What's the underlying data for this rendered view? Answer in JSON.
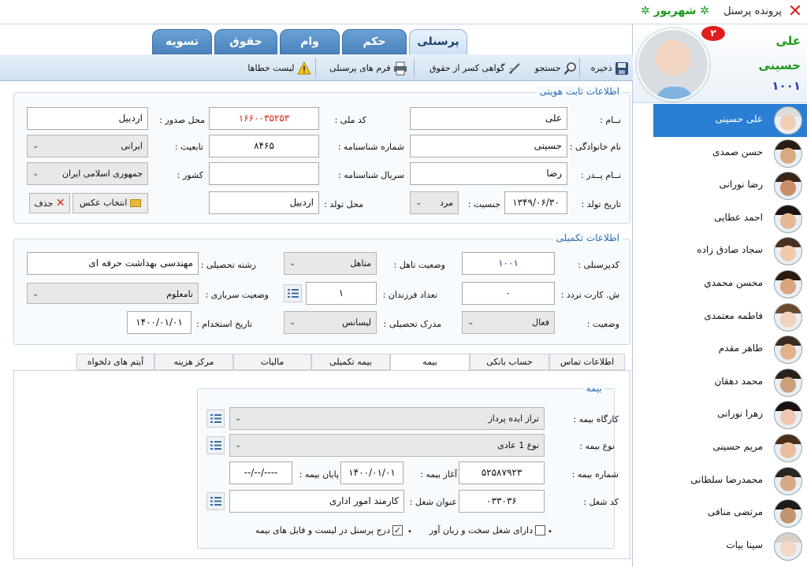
{
  "titlebar": {
    "title": "پرونده پرسنل",
    "month": "شهریور"
  },
  "profile": {
    "first_name": "علی",
    "last_name": "حسینی",
    "code": "۱۰۰۱",
    "badge": "۲"
  },
  "main_tabs": [
    "پرسنلی",
    "حکم",
    "وام",
    "حقوق",
    "تسویه"
  ],
  "toolbar": {
    "save": "ذخیره",
    "search": "جستجو",
    "cert": "گواهی کسر از حقوق",
    "forms": "فرم های پرسنلی",
    "errors": "لیست خطاها"
  },
  "identity": {
    "title": "اطلاعات ثابت هویتی",
    "first_name_label": "نــام :",
    "first_name": "علی",
    "national_code_label": "کد ملی :",
    "national_code": "۱۶۶۰۰۳۵۲۵۳",
    "issue_place_label": "محل صدور :",
    "issue_place": "اردبیل",
    "family_label": "نام خانوادگی :",
    "family": "حسینی",
    "id_number_label": "شماره شناسنامه :",
    "id_number": "۸۴۶۵",
    "nationality_label": "تابعیت :",
    "nationality": "ایرانی",
    "father_label": "نــام پــدر :",
    "father": "رضا",
    "id_serial_label": "سریال شناسنامه :",
    "id_serial": "",
    "country_label": "کشور :",
    "country": "جمهوری اسلامی ایران",
    "birthdate_label": "تاریخ تولد :",
    "birthdate": "۱۳۴۹/۰۶/۳۰",
    "gender_label": "جنسیت :",
    "gender": "مرد",
    "birthplace_label": "محل تولد :",
    "birthplace": "اردبیل",
    "choose_photo": "انتخاب عکس",
    "delete": "حذف"
  },
  "extra": {
    "title": "اطلاعات تکمیلی",
    "code_label": "کدپرسنلی :",
    "code": "۱۰۰۱",
    "marital_label": "وضعیت تاهل :",
    "marital": "متاهل",
    "field_label": "رشته تحصیلی :",
    "field": "مهندسی بهداشت حرفه ای",
    "card_label": "ش. کارت تردد :",
    "card": "۰",
    "children_label": "تعداد فرزندان :",
    "children": "۱",
    "military_label": "وضعیت سربازی :",
    "military": "نامعلوم",
    "status_label": "وضعیت :",
    "status": "فعال",
    "degree_label": "مدرک تحصیلی :",
    "degree": "لیسانس",
    "hire_label": "تاریخ استخدام :",
    "hire": "۱۴۰۰/۰۱/۰۱"
  },
  "sub_tabs": [
    "اطلاعات تماس",
    "حساب بانکی",
    "بیمه",
    "بیمه تکمیلی",
    "مالیات",
    "مرکز هزینه",
    "آیتم های دلخواه"
  ],
  "insurance": {
    "title": "بیمه",
    "workshop_label": "کارگاه بیمه :",
    "workshop": "تراز ایده پرداز",
    "type_label": "نوع بیمه :",
    "type": "نوع 1 عادی",
    "number_label": "شماره بیمه :",
    "number": "۵۲۵۸۷۹۲۳",
    "start_label": "آغاز بیمه :",
    "start": "۱۴۰۰/۰۱/۰۱",
    "end_label": "پایان بیمه :",
    "end": "--/--/----",
    "job_code_label": "کد شغل :",
    "job_code": "۰۳۳۰۳۶",
    "job_title_label": "عنوان شغل :",
    "job_title": "کارمند امور اداری",
    "hard_job_label": "دارای شغل سخت و زیان آور",
    "include_label": "درج پرسنل در لیست و فایل های بیمه"
  },
  "people": [
    "علی حسینی",
    "حسن صمدی",
    "رضا نورانی",
    "احمد عطایی",
    "سجاد صادق زاده",
    "محسن محمدي",
    "فاطمه معتمدی",
    "طاهر مقدم",
    "محمد دهقان",
    "زهرا نورانی",
    "مریم حسینی",
    "محمدرضا سلطانی",
    "مرتضی منافی",
    "سینا بیات"
  ],
  "colors": {
    "accent": "#2a7fd4",
    "tab_blue": "#4a82bc",
    "green": "#1a9a1a",
    "red_value": "#d8271e"
  }
}
